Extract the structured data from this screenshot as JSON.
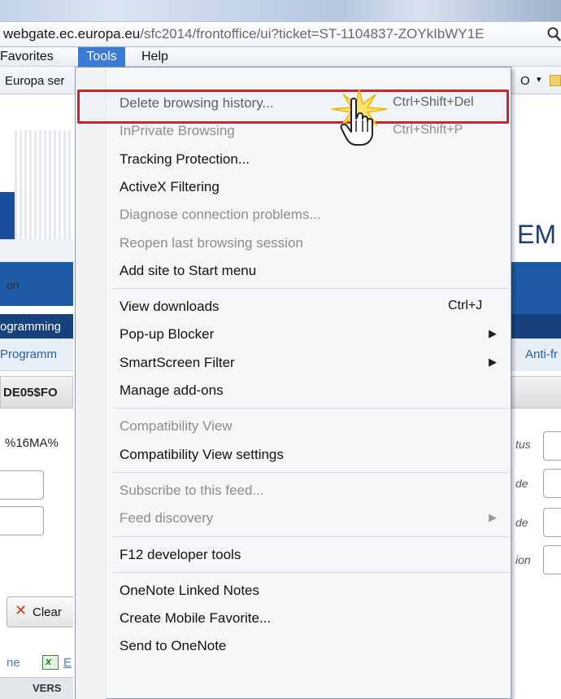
{
  "browser": {
    "address": {
      "host": "webgate.ec.europa.eu",
      "path": "/sfc2014/frontoffice/ui?ticket=ST-1104837-ZOYkIbWY1E"
    },
    "menubar": {
      "favorites": "Favorites",
      "tools": "Tools",
      "help": "Help"
    },
    "favorites_bar": {
      "europa_label": "Europa ser",
      "right_partial": "O",
      "right_chevron": "▾"
    }
  },
  "page_left": {
    "logo_text": "on",
    "nav_dark": "ogramming",
    "nav_light": "Programm",
    "id_text": "DE05$FO",
    "pct_text": "%16MA%",
    "clear_button": "Clear",
    "clear_icon": "✕",
    "link_left": "ne",
    "excel_icon_letter": "x",
    "link_e": "E",
    "table_col": "VERS"
  },
  "page_right": {
    "em_text": "EM",
    "anti_text": "Anti-fr",
    "labels": [
      "tus",
      "de",
      "de",
      "ion"
    ]
  },
  "tools_menu": {
    "groups": [
      {
        "items": [
          {
            "label": "Delete browsing history...",
            "shortcut": "Ctrl+Shift+Del",
            "enabled": true,
            "submenu": false,
            "highlighted": true
          },
          {
            "label": "InPrivate Browsing",
            "shortcut": "Ctrl+Shift+P",
            "enabled": false,
            "submenu": false
          },
          {
            "label": "Tracking Protection...",
            "shortcut": "",
            "enabled": true,
            "submenu": false
          },
          {
            "label": "ActiveX Filtering",
            "shortcut": "",
            "enabled": true,
            "submenu": false
          },
          {
            "label": "Diagnose connection problems...",
            "shortcut": "",
            "enabled": false,
            "submenu": false
          },
          {
            "label": "Reopen last browsing session",
            "shortcut": "",
            "enabled": false,
            "submenu": false
          },
          {
            "label": "Add site to Start menu",
            "shortcut": "",
            "enabled": true,
            "submenu": false
          }
        ]
      },
      {
        "items": [
          {
            "label": "View downloads",
            "shortcut": "Ctrl+J",
            "enabled": true,
            "submenu": false
          },
          {
            "label": "Pop-up Blocker",
            "shortcut": "",
            "enabled": true,
            "submenu": true
          },
          {
            "label": "SmartScreen Filter",
            "shortcut": "",
            "enabled": true,
            "submenu": true
          },
          {
            "label": "Manage add-ons",
            "shortcut": "",
            "enabled": true,
            "submenu": false
          }
        ]
      },
      {
        "items": [
          {
            "label": "Compatibility View",
            "shortcut": "",
            "enabled": false,
            "submenu": false
          },
          {
            "label": "Compatibility View settings",
            "shortcut": "",
            "enabled": true,
            "submenu": false
          }
        ]
      },
      {
        "items": [
          {
            "label": "Subscribe to this feed...",
            "shortcut": "",
            "enabled": false,
            "submenu": false
          },
          {
            "label": "Feed discovery",
            "shortcut": "",
            "enabled": false,
            "submenu": true
          }
        ]
      },
      {
        "items": [
          {
            "label": "F12 developer tools",
            "shortcut": "",
            "enabled": true,
            "submenu": false
          }
        ]
      },
      {
        "items": [
          {
            "label": "OneNote Linked Notes",
            "shortcut": "",
            "enabled": true,
            "submenu": false
          },
          {
            "label": "Create Mobile Favorite...",
            "shortcut": "",
            "enabled": true,
            "submenu": false
          },
          {
            "label": "Send to OneNote",
            "shortcut": "",
            "enabled": true,
            "submenu": false
          }
        ]
      }
    ],
    "submenu_arrow": "▶"
  },
  "colors": {
    "highlight_border": "#c4262e",
    "menu_active_bg": "#3a7bd5"
  },
  "icons": {
    "address_search": "search-icon",
    "cursor": "hand-pointer-icon",
    "click_burst": "click-burst-icon"
  }
}
